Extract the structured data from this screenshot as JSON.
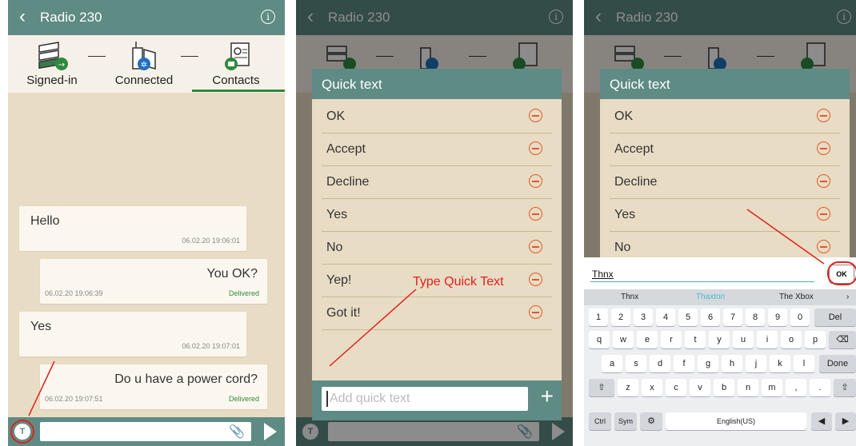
{
  "app": {
    "title": "Radio 230"
  },
  "steps": [
    {
      "label": "Signed-in"
    },
    {
      "label": "Connected"
    },
    {
      "label": "Contacts"
    }
  ],
  "messages": [
    {
      "text": "Hello",
      "timestamp": "06.02.20 19:06:01",
      "status": ""
    },
    {
      "text": "You OK?",
      "timestamp": "06.02.20 19:06:39",
      "status": "Delivered"
    },
    {
      "text": "Yes",
      "timestamp": "06.02.20 19:07:01",
      "status": ""
    },
    {
      "text": "Do u have a power cord?",
      "timestamp": "06.02.20 19:07:51",
      "status": "Delivered"
    }
  ],
  "quick_text": {
    "title": "Quick text",
    "items": [
      "OK",
      "Accept",
      "Decline",
      "Yes",
      "No",
      "Yep!",
      "Got it!"
    ],
    "placeholder": "Add quick text"
  },
  "annotation": {
    "type_quick_text": "Type Quick Text"
  },
  "keyboard": {
    "typed": "Thnx",
    "ok_label": "OK",
    "suggestions": [
      "Thnx",
      "Thaxton",
      "The Xbox"
    ],
    "row_numbers": [
      "1",
      "2",
      "3",
      "4",
      "5",
      "6",
      "7",
      "8",
      "9",
      "0",
      "Del"
    ],
    "row_q": [
      "q",
      "w",
      "e",
      "r",
      "t",
      "y",
      "u",
      "i",
      "o",
      "p"
    ],
    "row_a": [
      "a",
      "s",
      "d",
      "f",
      "g",
      "h",
      "j",
      "k",
      "l",
      "Done"
    ],
    "row_z": [
      "z",
      "x",
      "c",
      "v",
      "b",
      "n",
      "m",
      ",",
      "."
    ],
    "row_bottom": {
      "ctrl": "Ctrl",
      "sym": "Sym",
      "space": "English(US)"
    }
  },
  "colors": {
    "header": "#5e8b84",
    "background": "#e8dcc4",
    "accent_green": "#2f8a3e",
    "remove_orange": "#e05a2b",
    "annotation_red": "#e02020"
  }
}
